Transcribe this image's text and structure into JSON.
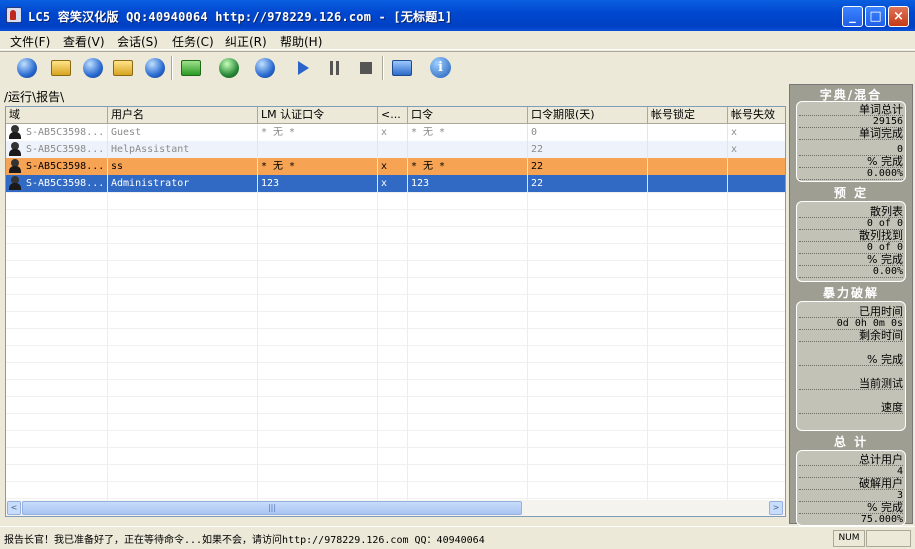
{
  "window": {
    "title": "LC5 容笑汉化版 QQ:40940064 http://978229.126.com - [无标题1]",
    "min": "_",
    "max": "□",
    "close": "×"
  },
  "menu": [
    "文件(F)",
    "查看(V)",
    "会话(S)",
    "任务(C)",
    "纠正(R)",
    "帮助(H)"
  ],
  "tabs": {
    "run": "运行",
    "report": "报告"
  },
  "columns": [
    "域",
    "用户名",
    "LM 认证口令",
    "<...",
    "口令",
    "口令期限(天)",
    "帐号锁定",
    "帐号失效"
  ],
  "rows": [
    {
      "domain": "S-AB5C3598...",
      "user": "Guest",
      "lm": "* 无  *",
      "lt": "x",
      "pw": "* 无  *",
      "age": "0",
      "lock": "",
      "dis": "x",
      "style": "dim"
    },
    {
      "domain": "S-AB5C3598...",
      "user": "HelpAssistant",
      "lm": "",
      "lt": "",
      "pw": "",
      "age": "22",
      "lock": "",
      "dis": "x",
      "style": "dim-blue"
    },
    {
      "domain": "S-AB5C3598...",
      "user": "ss",
      "lm": "* 无  *",
      "lt": "x",
      "pw": "* 无  *",
      "age": "22",
      "lock": "",
      "dis": "",
      "style": "orange"
    },
    {
      "domain": "S-AB5C3598...",
      "user": "Administrator",
      "lm": "123",
      "lt": "x",
      "pw": "123",
      "age": "22",
      "lock": "",
      "dis": "",
      "style": "selected"
    }
  ],
  "scrollbar": {
    "left": "<",
    "right": ">",
    "grip": "|||"
  },
  "panel": {
    "dict": {
      "header": "字典/混合",
      "words_total_label": "单词总计",
      "words_total": "29156",
      "words_done_label": "单词完成",
      "words_done": "0",
      "pct_label": "% 完成",
      "pct": "0.000%"
    },
    "precomp": {
      "header": "预 定",
      "hash_table_label": "散列表",
      "hash_table": "0 of 0",
      "hash_found_label": "散列找到",
      "hash_found": "0 of 0",
      "pct_label": "% 完成",
      "pct": "0.00%"
    },
    "brute": {
      "header": "暴力破解",
      "elapsed_label": "已用时间",
      "elapsed": "0d 0h 0m 0s",
      "remaining_label": "剩余时间",
      "pct_label": "% 完成",
      "current_label": "当前测试",
      "speed_label": "速度"
    },
    "summary": {
      "header": "总 计",
      "total_users_label": "总计用户",
      "total_users": "4",
      "cracked_label": "破解用户",
      "cracked": "3",
      "pct_label": "% 完成",
      "pct": "75.000%"
    }
  },
  "status": {
    "text": "报告长官！我已准备好了，正在等待命令...如果不会，请访问http://978229.126.com QQ：40940064",
    "num": "NUM"
  }
}
